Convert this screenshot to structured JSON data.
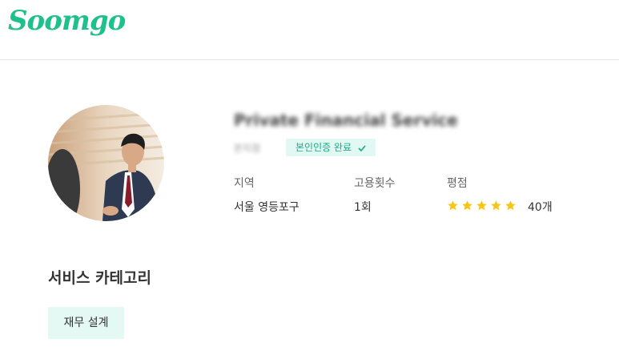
{
  "header": {
    "logo_text": "Soomgo"
  },
  "profile": {
    "name": "Private Financial Service",
    "subtitle": "본지점",
    "verify_badge": "본인인증 완료",
    "info": {
      "region_label": "지역",
      "region_value": "서울 영등포구",
      "hires_label": "고용횟수",
      "hires_value": "1회",
      "rating_label": "평점",
      "rating_stars": 5,
      "review_count": "40개"
    }
  },
  "services": {
    "title": "서비스 카테고리",
    "categories": [
      "재무 설계"
    ]
  },
  "colors": {
    "brand": "#1ec08b",
    "star": "#f5c518",
    "badge_bg": "#e2f8f3"
  }
}
